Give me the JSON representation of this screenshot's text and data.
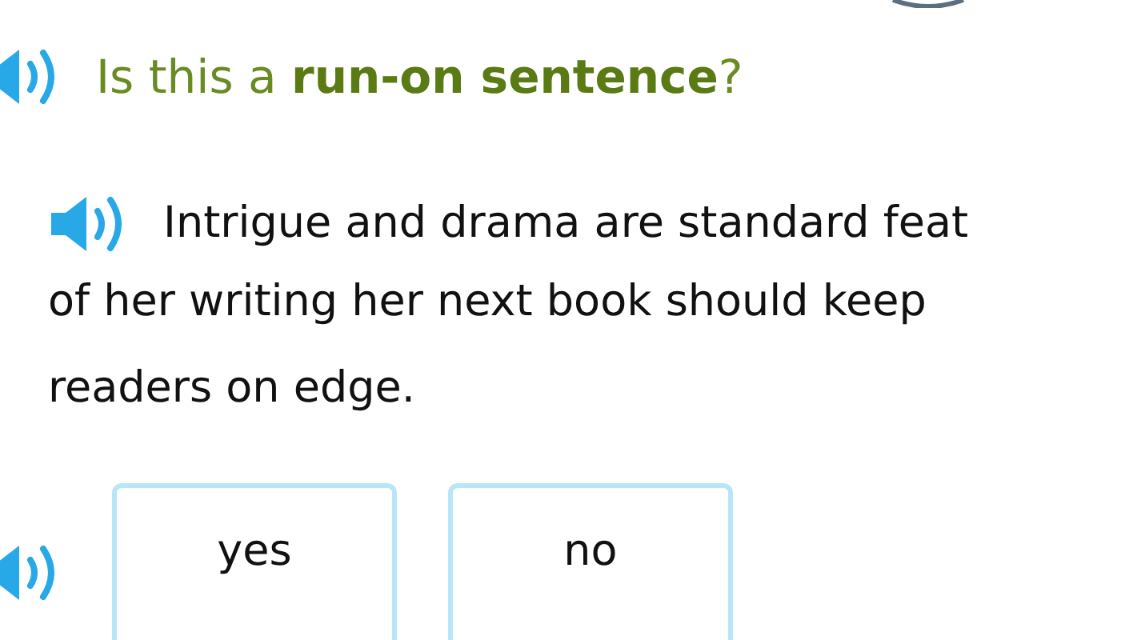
{
  "question": "Is this a **run-on sentence**?",
  "passage_lines": [
    "Intrigue and drama are standard feat",
    "of her writing her next book should keep",
    "readers on edge."
  ],
  "choices": [
    {
      "label": "yes",
      "selected": false
    },
    {
      "label": "no",
      "selected": false
    }
  ]
}
